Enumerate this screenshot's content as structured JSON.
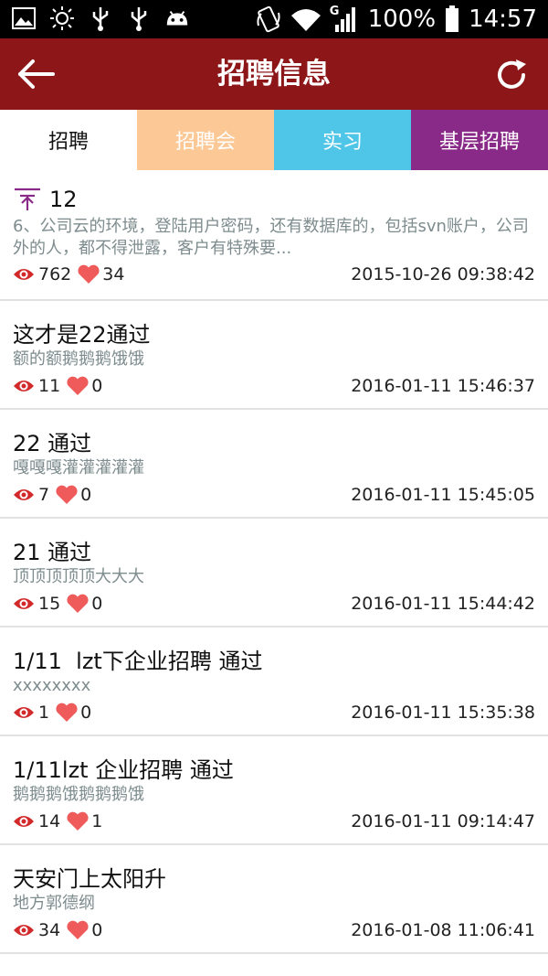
{
  "status_bar": {
    "battery": "100%",
    "time": "14:57",
    "network_label": "G",
    "left_icons": [
      "image-icon",
      "brightness-icon",
      "usb-icon",
      "usb-icon",
      "android-icon"
    ],
    "right_icons": [
      "rotate-icon",
      "wifi-icon",
      "signal-icon",
      "battery-icon"
    ]
  },
  "toolbar": {
    "title": "招聘信息",
    "back_icon": "arrow-left-icon",
    "refresh_icon": "refresh-icon",
    "background": "#8d1618"
  },
  "tabs": [
    {
      "label": "招聘",
      "color": "#ffffff",
      "selected": true
    },
    {
      "label": "招聘会",
      "color": "#fcc896"
    },
    {
      "label": "实习",
      "color": "#4fc6e7"
    },
    {
      "label": "基层招聘",
      "color": "#8a2a88"
    }
  ],
  "list": [
    {
      "title": "12",
      "pinned": true,
      "desc": "6、公司云的环境，登陆用户密码，还有数据库的，包括svn账户，公司外的人，都不得泄露，客户有特殊要...",
      "views": "762",
      "likes": "34",
      "date": "2015-10-26 09:38:42"
    },
    {
      "title": "这才是22通过",
      "desc": "额的额鹅鹅鹅饿饿",
      "views": "11",
      "likes": "0",
      "date": "2016-01-11 15:46:37"
    },
    {
      "title": "22 通过",
      "desc": "嘎嘎嘎灌灌灌灌灌",
      "views": "7",
      "likes": "0",
      "date": "2016-01-11 15:45:05"
    },
    {
      "title": "21 通过",
      "desc": "顶顶顶顶顶大大大",
      "views": "15",
      "likes": "0",
      "date": "2016-01-11 15:44:42"
    },
    {
      "title": "1/11  lzt下企业招聘 通过",
      "desc": "xxxxxxxx",
      "views": "1",
      "likes": "0",
      "date": "2016-01-11 15:35:38"
    },
    {
      "title": "1/11lzt 企业招聘 通过",
      "desc": "鹅鹅鹅饿鹅鹅鹅饿",
      "views": "14",
      "likes": "1",
      "date": "2016-01-11 09:14:47"
    },
    {
      "title": "天安门上太阳升",
      "desc": "地方郭德纲",
      "views": "34",
      "likes": "0",
      "date": "2016-01-08 11:06:41"
    }
  ],
  "colors": {
    "eye": "#d22a2a",
    "heart": "#ef5a5a",
    "pin": "#8a2a88",
    "desc_text": "#7e8c8e"
  }
}
